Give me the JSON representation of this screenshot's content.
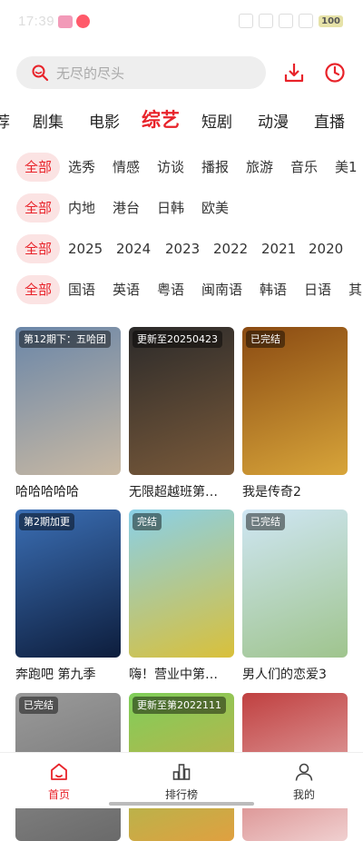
{
  "status": {
    "time": "17:39",
    "battery": "100"
  },
  "search": {
    "placeholder": "无尽的尽头"
  },
  "tabs": [
    "荐",
    "剧集",
    "电影",
    "综艺",
    "短剧",
    "动漫",
    "直播"
  ],
  "active_tab": "综艺",
  "filters": [
    {
      "active": "全部",
      "items": [
        "选秀",
        "情感",
        "访谈",
        "播报",
        "旅游",
        "音乐",
        "美1"
      ]
    },
    {
      "active": "全部",
      "items": [
        "内地",
        "港台",
        "日韩",
        "欧美"
      ]
    },
    {
      "active": "全部",
      "items": [
        "2025",
        "2024",
        "2023",
        "2022",
        "2021",
        "2020"
      ]
    },
    {
      "active": "全部",
      "items": [
        "国语",
        "英语",
        "粤语",
        "闽南语",
        "韩语",
        "日语",
        "其"
      ]
    }
  ],
  "cards": [
    {
      "badge": "第12期下：五哈团",
      "title": "哈哈哈哈哈",
      "color1": "#6a86a8",
      "color2": "#c9b9a3"
    },
    {
      "badge": "更新至20250423",
      "title": "无限超越班第…",
      "color1": "#2b2a2a",
      "color2": "#7a5a3a"
    },
    {
      "badge": "已完结",
      "title": "我是传奇2",
      "color1": "#8a4a12",
      "color2": "#d8a53a"
    },
    {
      "badge": "第2期加更",
      "title": "奔跑吧 第九季",
      "color1": "#3b6fb5",
      "color2": "#0d1d3c"
    },
    {
      "badge": "完结",
      "title": "嗨！营业中第…",
      "color1": "#8ad0e8",
      "color2": "#d9c03a"
    },
    {
      "badge": "已完结",
      "title": "男人们的恋爱3",
      "color1": "#cfe6f4",
      "color2": "#9fc48d"
    },
    {
      "badge": "已完结",
      "title": "",
      "color1": "#9a9a9a",
      "color2": "#6a6a6a"
    },
    {
      "badge": "更新至第2022111",
      "title": "",
      "color1": "#7fcf5a",
      "color2": "#e0a040"
    },
    {
      "badge": "",
      "title": "",
      "color1": "#c04040",
      "color2": "#f0d0d0"
    }
  ],
  "bottom_nav": [
    {
      "label": "首页",
      "icon": "home-icon"
    },
    {
      "label": "排行榜",
      "icon": "chart-icon"
    },
    {
      "label": "我的",
      "icon": "user-icon"
    }
  ],
  "accent_color": "#e8232a"
}
